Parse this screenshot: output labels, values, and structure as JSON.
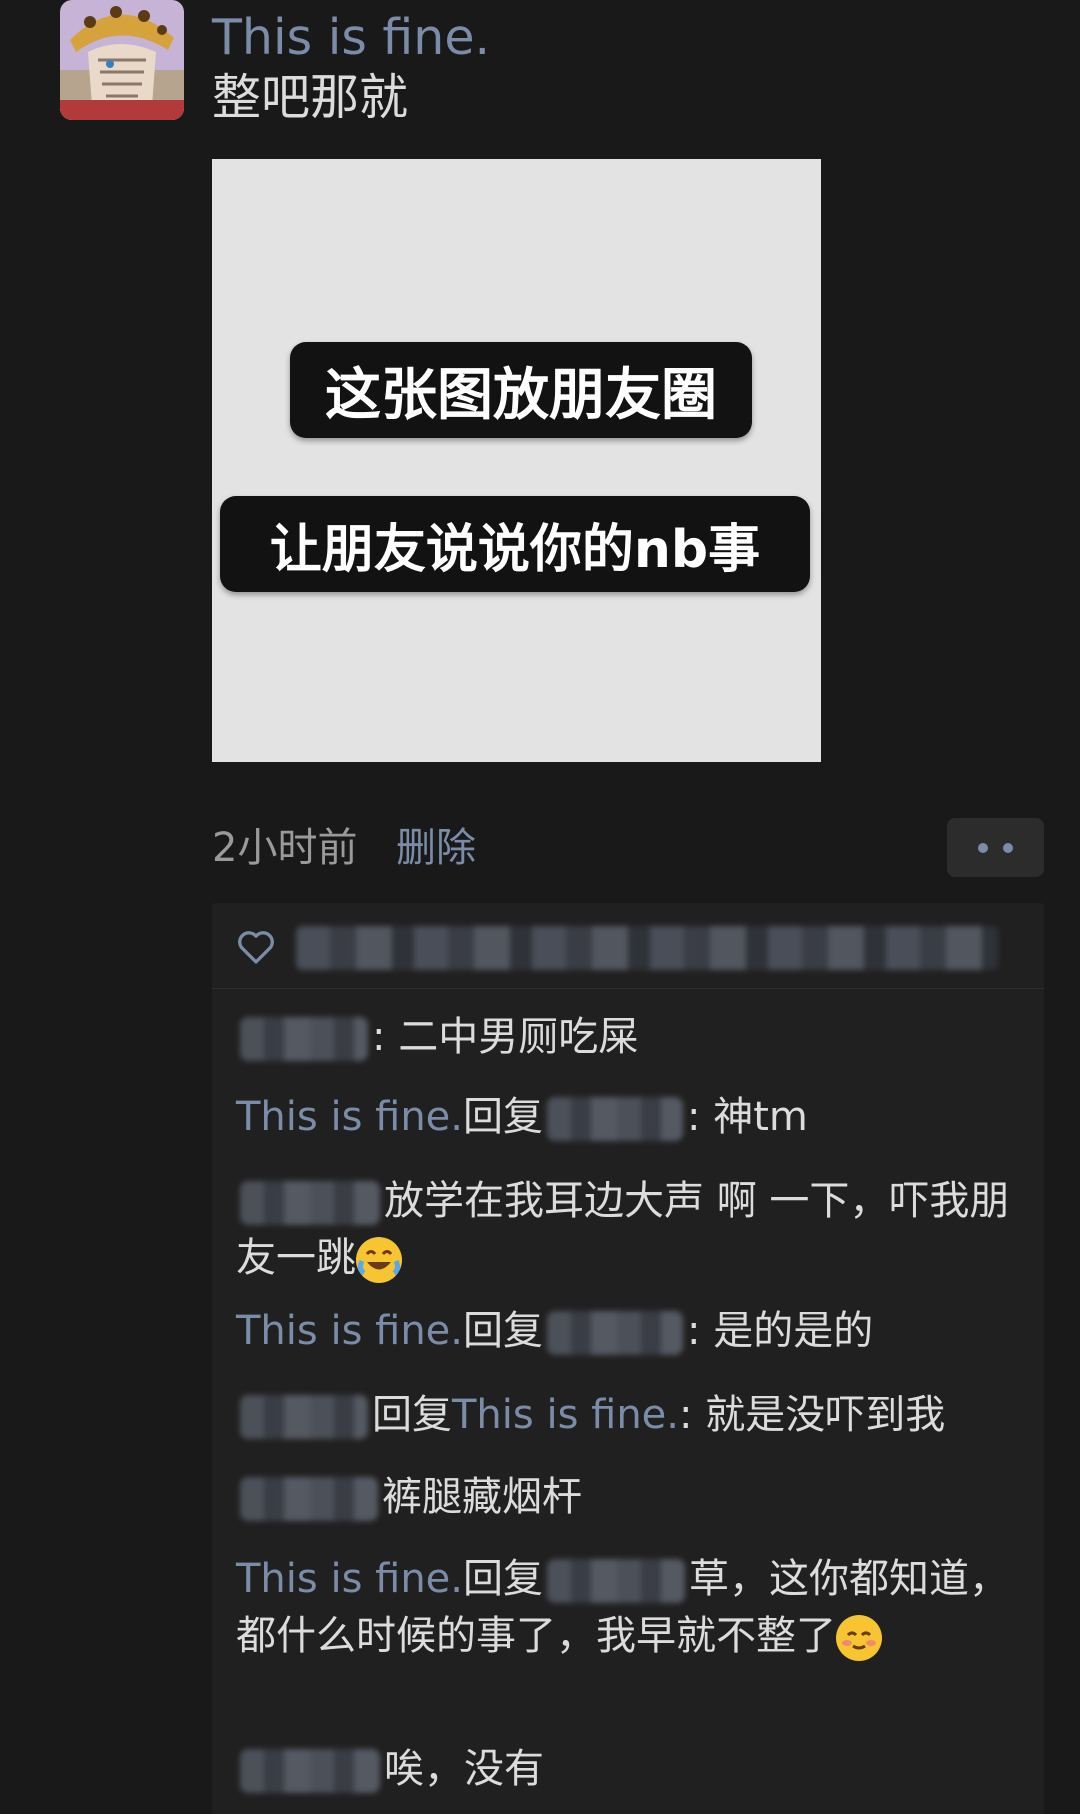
{
  "post": {
    "author": "This is fine.",
    "text": "整吧那就",
    "image_caption_line1": "这张图放朋友圈",
    "image_caption_line2": "让朋友说说你的nb事",
    "time": "2小时前",
    "delete_label": "删除"
  },
  "comments": [
    {
      "suffix": ": 二中男厕吃屎"
    },
    {
      "name": "This is fine.",
      "reply": "回复",
      "suffix": ": 神tm"
    },
    {
      "suffix": "放学在我耳边大声  啊  一下，吓我朋友一跳",
      "emoji": "laughing-tears"
    },
    {
      "name": "This is fine.",
      "reply": "回复",
      "suffix": ": 是的是的"
    },
    {
      "reply": "回复",
      "target": "This is fine.",
      "suffix": ": 就是没吓到我"
    },
    {
      "suffix": "裤腿藏烟杆"
    },
    {
      "name": "This is fine.",
      "reply": "回复",
      "suffix": "草，这你都知道，都什么时候的事了，我早就不整了",
      "emoji": "blushing-face"
    },
    {
      "suffix": "唉，没有"
    }
  ],
  "colors": {
    "background": "#191919",
    "comment_box": "#202020",
    "name_link": "#7b8ca8",
    "text": "#dcdcdc",
    "time": "#9a9a9a"
  }
}
